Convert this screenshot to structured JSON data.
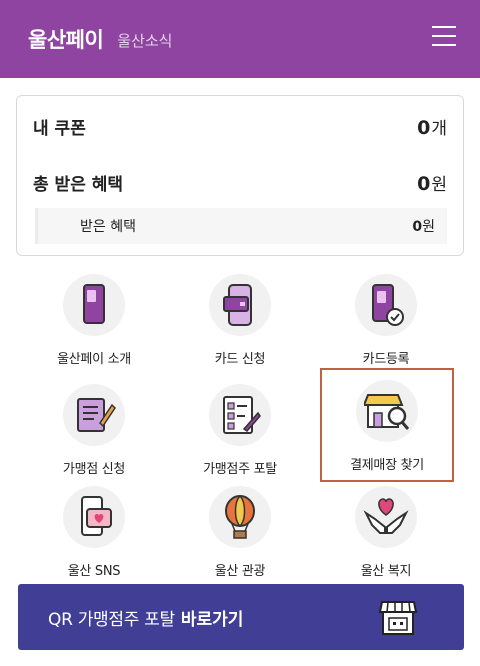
{
  "header": {
    "title": "울산페이",
    "subtitle": "울산소식",
    "menu_icon": "hamburger-icon"
  },
  "summary": {
    "coupon": {
      "label": "내 쿠폰",
      "value": "0",
      "unit": "개"
    },
    "benefit_total": {
      "label": "총 받은 혜택",
      "value": "0",
      "unit": "원"
    },
    "benefit_received": {
      "label": "받은 혜택",
      "value": "0",
      "unit": "원"
    }
  },
  "menu": {
    "items": [
      {
        "label": "울산페이 소개",
        "icon": "phone-icon"
      },
      {
        "label": "카드 신청",
        "icon": "card-phone-icon"
      },
      {
        "label": "카드등록",
        "icon": "phone-check-icon"
      },
      {
        "label": "가맹점 신청",
        "icon": "document-pen-icon"
      },
      {
        "label": "가맹점주 포탈",
        "icon": "checklist-icon"
      },
      {
        "label": "결제매장 찾기",
        "icon": "store-search-icon"
      },
      {
        "label": "울산 SNS",
        "icon": "phone-heart-icon"
      },
      {
        "label": "울산 관광",
        "icon": "hot-air-balloon-icon"
      },
      {
        "label": "울산 복지",
        "icon": "hands-heart-icon"
      }
    ]
  },
  "qr_banner": {
    "text": "QR 가맹점주 포탈",
    "action": "바로가기",
    "icon": "store-icon"
  },
  "colors": {
    "header": "#8e44a0",
    "banner": "#403e95",
    "highlight": "#c0623f",
    "icon_purple": "#8e44a0"
  }
}
